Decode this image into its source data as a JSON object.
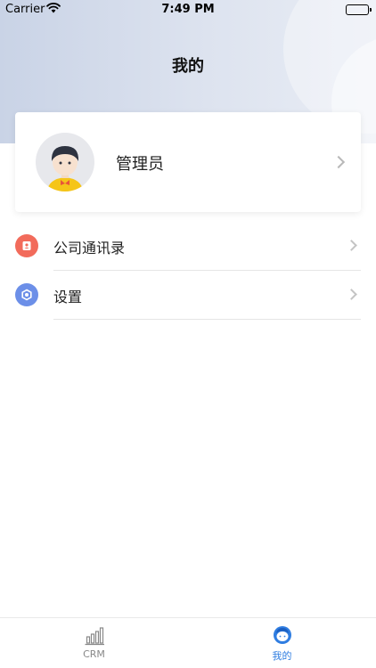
{
  "status_bar": {
    "carrier": "Carrier",
    "time": "7:49 PM"
  },
  "header": {
    "title": "我的"
  },
  "profile": {
    "name": "管理员"
  },
  "menu": {
    "items": [
      {
        "label": "公司通讯录",
        "icon": "address-book-icon",
        "color": "#f26b5b"
      },
      {
        "label": "设置",
        "icon": "settings-icon",
        "color": "#6c8fe8"
      }
    ]
  },
  "tab_bar": {
    "tabs": [
      {
        "label": "CRM",
        "icon": "bar-chart-icon",
        "active": false
      },
      {
        "label": "我的",
        "icon": "user-icon",
        "active": true
      }
    ],
    "active_color": "#2f7de1",
    "inactive_color": "#888888"
  }
}
